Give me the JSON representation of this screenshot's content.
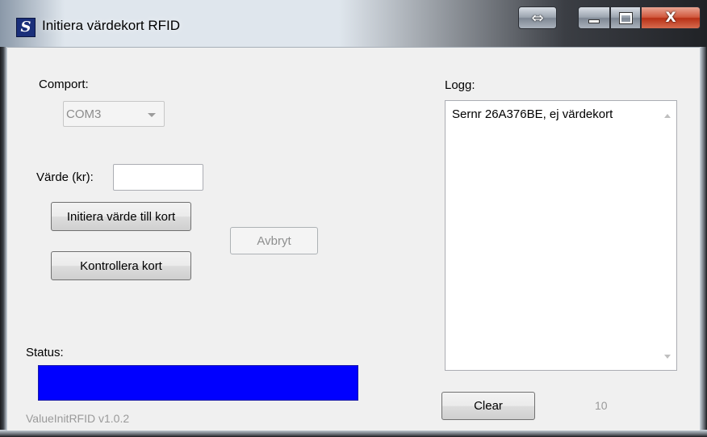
{
  "window": {
    "title": "Initiera värdekort RFID",
    "icon_letter": "S",
    "resize_glyph": "⇔",
    "close_glyph": "X"
  },
  "form": {
    "comport_label": "Comport:",
    "comport_value": "COM3",
    "value_label": "Värde (kr):",
    "value_input": "",
    "init_button": "Initiera värde till kort",
    "cancel_button": "Avbryt",
    "check_button": "Kontrollera kort",
    "status_label": "Status:",
    "status_progress": 1.0,
    "status_color": "#0000ff",
    "version": "ValueInitRFID v1.0.2"
  },
  "log": {
    "label": "Logg:",
    "lines": [
      "Sernr 26A376BE, ej värdekort"
    ],
    "clear_button": "Clear",
    "count": "10"
  }
}
